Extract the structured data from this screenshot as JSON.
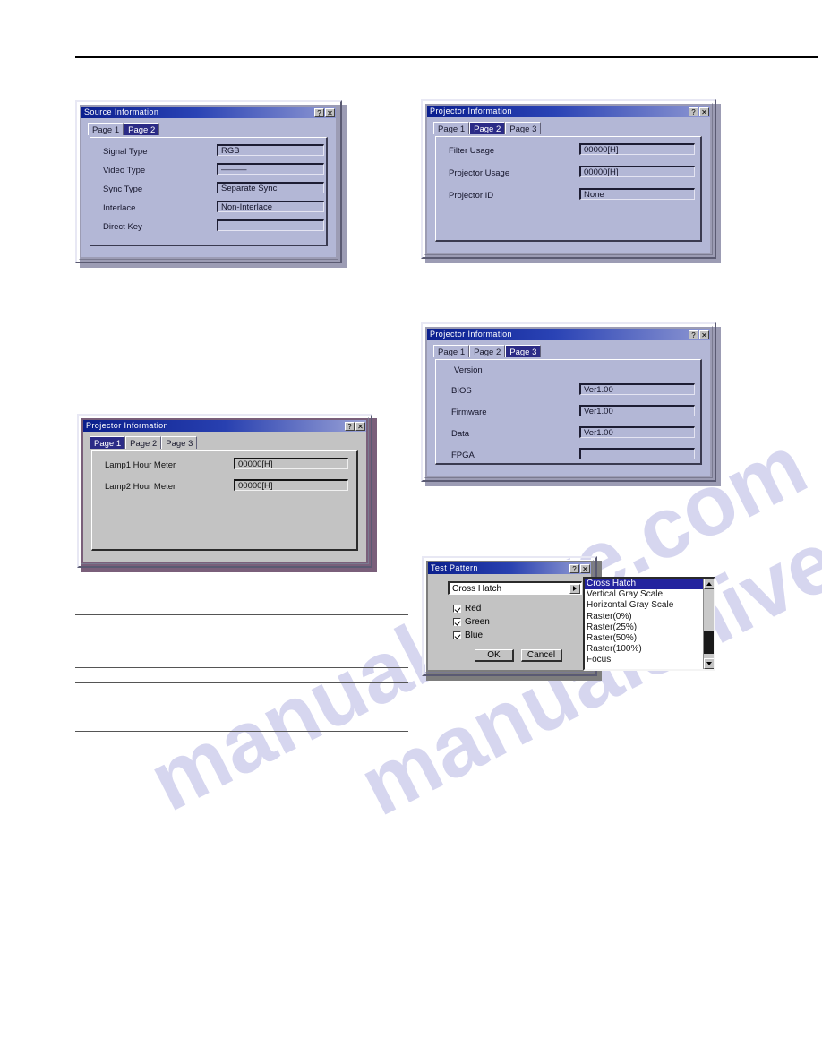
{
  "page": {
    "watermark_line1": "manualshive.com",
    "watermark_line2": "manualshive.com"
  },
  "source_information": {
    "title": "Source Information",
    "help_btn": "?",
    "close_btn": "✕",
    "tabs": [
      {
        "label": "Page 1",
        "selected": false
      },
      {
        "label": "Page 2",
        "selected": true
      }
    ],
    "fields": [
      {
        "label": "Signal Type",
        "value": "RGB"
      },
      {
        "label": "Video Type",
        "value": "———"
      },
      {
        "label": "Sync Type",
        "value": "Separate Sync"
      },
      {
        "label": "Interlace",
        "value": "Non-Interlace"
      },
      {
        "label": "Direct Key",
        "value": ""
      }
    ]
  },
  "projector_information_page2": {
    "title": "Projector Information",
    "help_btn": "?",
    "close_btn": "✕",
    "tabs": [
      {
        "label": "Page 1",
        "selected": false
      },
      {
        "label": "Page 2",
        "selected": true
      },
      {
        "label": "Page 3",
        "selected": false
      }
    ],
    "fields": [
      {
        "label": "Filter Usage",
        "value": "00000[H]"
      },
      {
        "label": "Projector Usage",
        "value": "00000[H]"
      },
      {
        "label": "Projector ID",
        "value": "None"
      }
    ]
  },
  "projector_information_page3": {
    "title": "Projector Information",
    "help_btn": "?",
    "close_btn": "✕",
    "tabs": [
      {
        "label": "Page 1",
        "selected": false
      },
      {
        "label": "Page 2",
        "selected": false
      },
      {
        "label": "Page 3",
        "selected": true
      }
    ],
    "group_label": "Version",
    "fields": [
      {
        "label": "BIOS",
        "value": "Ver1.00"
      },
      {
        "label": "Firmware",
        "value": "Ver1.00"
      },
      {
        "label": "Data",
        "value": "Ver1.00"
      },
      {
        "label": "FPGA",
        "value": ""
      }
    ]
  },
  "projector_information_page1": {
    "title": "Projector Information",
    "help_btn": "?",
    "close_btn": "✕",
    "tabs": [
      {
        "label": "Page 1",
        "selected": true
      },
      {
        "label": "Page 2",
        "selected": false
      },
      {
        "label": "Page 3",
        "selected": false
      }
    ],
    "fields": [
      {
        "label": "Lamp1 Hour Meter",
        "value": "00000[H]"
      },
      {
        "label": "Lamp2 Hour Meter",
        "value": "00000[H]"
      }
    ]
  },
  "test_pattern": {
    "title": "Test Pattern",
    "help_btn": "?",
    "close_btn": "✕",
    "combo_value": "Cross Hatch",
    "checkboxes": [
      {
        "label": "Red",
        "checked": true
      },
      {
        "label": "Green",
        "checked": true
      },
      {
        "label": "Blue",
        "checked": true
      }
    ],
    "ok_label": "OK",
    "cancel_label": "Cancel",
    "list_options": [
      "Cross Hatch",
      "Vertical Gray Scale",
      "Horizontal Gray Scale",
      "Raster(0%)",
      "Raster(25%)",
      "Raster(50%)",
      "Raster(100%)",
      "Focus"
    ],
    "list_selected_index": 0
  },
  "colors": {
    "dialog_lavender": "#b3b7d6",
    "dialog_gray": "#c3c3c3",
    "titlebar_blue": "#0b1f8f",
    "tab_selected": "#2b2b86",
    "list_highlight": "#23239e"
  }
}
